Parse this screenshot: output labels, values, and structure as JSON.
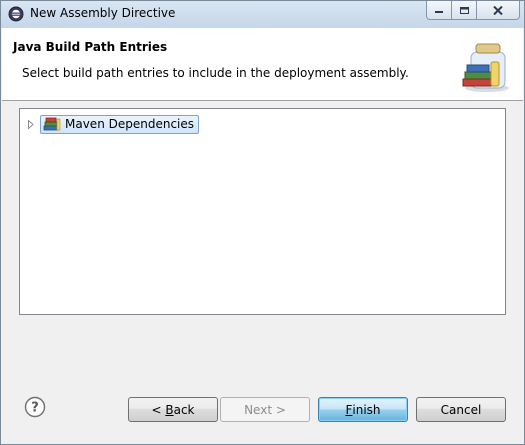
{
  "window": {
    "title": "New Assembly Directive"
  },
  "banner": {
    "title": "Java Build Path Entries",
    "description": "Select build path entries to include in the deployment assembly."
  },
  "tree": {
    "items": [
      {
        "label": "Maven Dependencies",
        "icon": "library-books-icon",
        "expanded": false,
        "selected": true
      }
    ]
  },
  "buttons": {
    "back_prefix": "< ",
    "back_mnemonic": "B",
    "back_rest": "ack",
    "next_label": "Next >",
    "finish_mnemonic": "F",
    "finish_rest": "inish",
    "cancel_label": "Cancel"
  },
  "help": {
    "glyph": "?"
  }
}
